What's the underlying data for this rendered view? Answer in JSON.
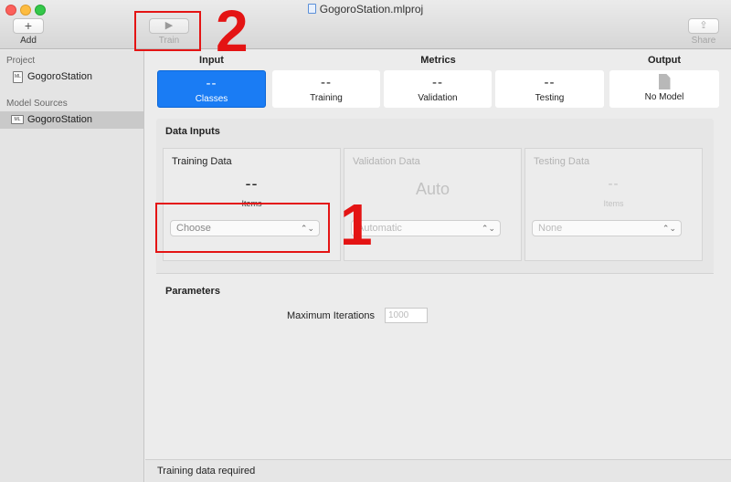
{
  "window": {
    "title": "GogoroStation.mlproj",
    "toolbar": {
      "add_label": "Add",
      "train_label": "Train",
      "share_label": "Share"
    }
  },
  "sidebar": {
    "project_header": "Project",
    "project_item": "GogoroStation",
    "sources_header": "Model Sources",
    "source_item": "GogoroStation",
    "ml_badge": "ML"
  },
  "header": {
    "input_title": "Input",
    "metrics_title": "Metrics",
    "output_title": "Output",
    "classes": {
      "value": "--",
      "label": "Classes"
    },
    "training": {
      "value": "--",
      "label": "Training"
    },
    "validation": {
      "value": "--",
      "label": "Validation"
    },
    "testing": {
      "value": "--",
      "label": "Testing"
    },
    "output": {
      "label": "No Model"
    }
  },
  "data_inputs": {
    "title": "Data Inputs",
    "training": {
      "title": "Training Data",
      "count": "--",
      "unit": "Items",
      "select": "Choose"
    },
    "validation": {
      "title": "Validation Data",
      "count": "Auto",
      "select": "Automatic"
    },
    "testing": {
      "title": "Testing Data",
      "count": "--",
      "unit": "Items",
      "select": "None"
    }
  },
  "parameters": {
    "title": "Parameters",
    "max_iter_label": "Maximum Iterations",
    "max_iter_placeholder": "1000"
  },
  "status": {
    "text": "Training data required"
  },
  "annotations": {
    "one": "1",
    "two": "2",
    "color": "#e41414"
  },
  "colors": {
    "accent": "#1a7cf4"
  }
}
